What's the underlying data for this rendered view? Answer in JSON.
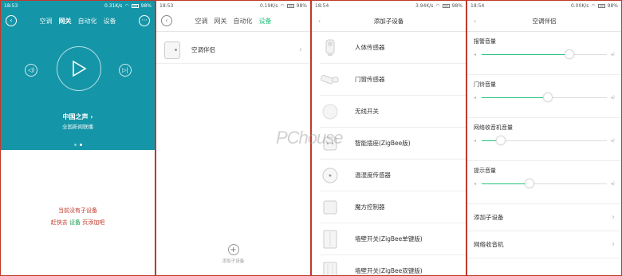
{
  "panel1": {
    "status": {
      "time": "18:53",
      "speed": "0.31K/s",
      "battery": "98%"
    },
    "tabs": [
      "空调",
      "网关",
      "自动化",
      "设备"
    ],
    "active_tab": 1,
    "station": "中国之声 ›",
    "station_sub": "全国新闻联播",
    "empty_line1": "当前没有子设备",
    "empty_line2_a": "赶快去",
    "empty_line2_link": "设备",
    "empty_line2_b": "页添加吧"
  },
  "panel2": {
    "status": {
      "time": "18:53",
      "speed": "0.19K/s",
      "battery": "98%"
    },
    "tabs": [
      "空调",
      "网关",
      "自动化",
      "设备"
    ],
    "active_tab": 3,
    "device": "空调伴侣",
    "add_label": "添加子设备"
  },
  "panel3": {
    "status": {
      "time": "18:54",
      "speed": "3.94K/s",
      "battery": "98%"
    },
    "title": "添加子设备",
    "items": [
      {
        "label": "人体传感器",
        "icon": "motion-sensor-icon"
      },
      {
        "label": "门窗传感器",
        "icon": "door-sensor-icon"
      },
      {
        "label": "无线开关",
        "icon": "wireless-switch-icon"
      },
      {
        "label": "智能插座(ZigBee版)",
        "icon": "smart-plug-icon"
      },
      {
        "label": "温湿度传感器",
        "icon": "temp-humidity-sensor-icon"
      },
      {
        "label": "魔方控制器",
        "icon": "cube-controller-icon"
      },
      {
        "label": "墙壁开关(ZigBee单键版)",
        "icon": "wall-switch-single-icon"
      },
      {
        "label": "墙壁开关(ZigBee双键版)",
        "icon": "wall-switch-double-icon"
      }
    ]
  },
  "panel4": {
    "status": {
      "time": "18:54",
      "speed": "0.00K/s",
      "battery": "98%"
    },
    "title": "空调伴侣",
    "volumes": [
      {
        "label": "报警音量",
        "level": 0.7
      },
      {
        "label": "门铃音量",
        "level": 0.53
      },
      {
        "label": "网络收音机音量",
        "level": 0.15
      },
      {
        "label": "提示音量",
        "level": 0.38
      }
    ],
    "menu": [
      "添加子设备",
      "网络收音机"
    ]
  },
  "watermark": "PChouse",
  "colors": {
    "teal": "#1596a8",
    "green": "#21c17a",
    "red_text": "#c0392b"
  }
}
